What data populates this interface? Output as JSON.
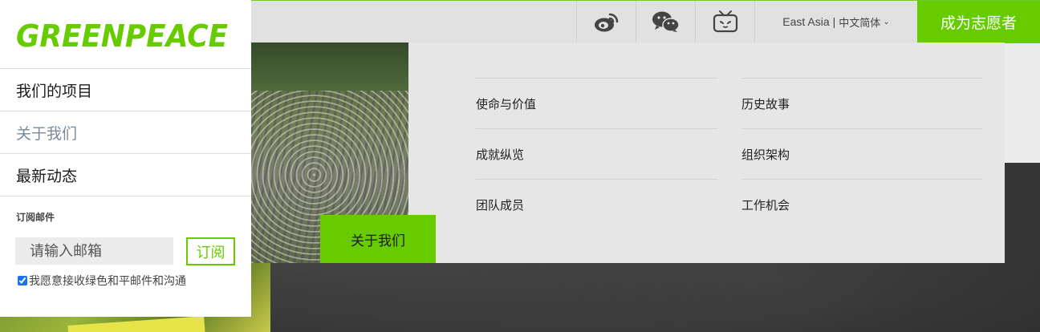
{
  "brand": {
    "logo_text": "GREENPEACE",
    "accent_color": "#66cc00"
  },
  "topbar": {
    "social": [
      {
        "name": "weibo-icon"
      },
      {
        "name": "wechat-icon"
      },
      {
        "name": "bilibili-icon"
      }
    ],
    "region_label": "East Asia",
    "separator": "|",
    "language_label": "中文简体",
    "language_chevron": "⌄",
    "volunteer_label": "成为志愿者"
  },
  "sidebar": {
    "nav": [
      {
        "label": "我们的项目",
        "active": false
      },
      {
        "label": "关于我们",
        "active": true
      },
      {
        "label": "最新动态",
        "active": false
      }
    ],
    "subscribe": {
      "heading": "订阅邮件",
      "email_placeholder": "请输入邮箱",
      "button_label": "订阅",
      "consent_label": "我愿意接收绿色和平邮件和沟通",
      "consent_checked": true
    }
  },
  "dropdown": {
    "tab_label": "关于我们",
    "left_items": [
      "使命与价值",
      "成就纵览",
      "团队成员"
    ],
    "right_items": [
      "历史故事",
      "组织架构",
      "工作机会"
    ]
  }
}
